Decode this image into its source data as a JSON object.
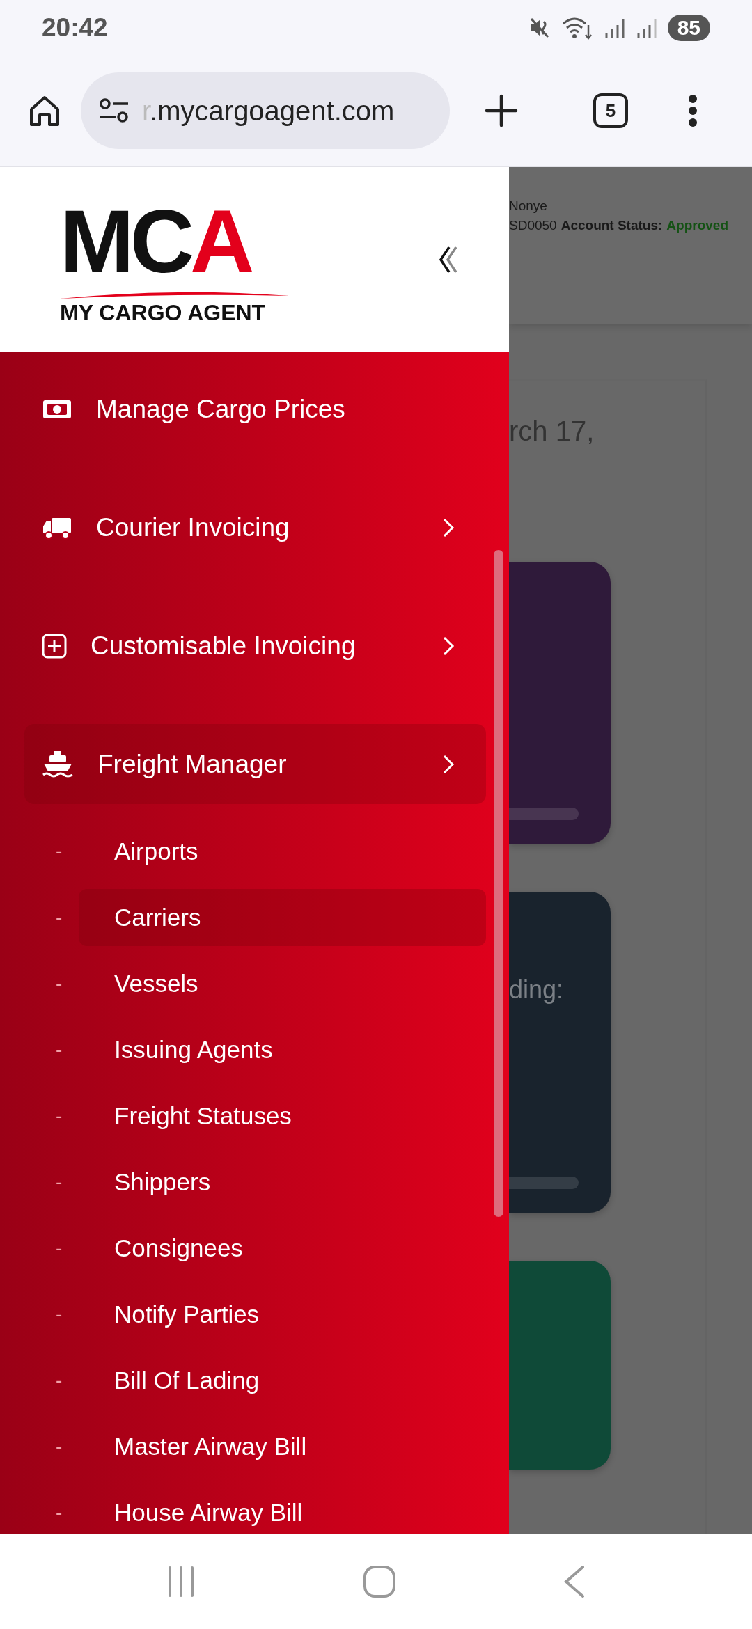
{
  "status_bar": {
    "time": "20:42",
    "battery": "85"
  },
  "browser": {
    "url_hidden": "r",
    "url": ".mycargoagent.com",
    "tab_count": "5"
  },
  "drawer": {
    "logo": {
      "mark": "MCA",
      "tagline": "MY CARGO AGENT"
    },
    "menu": [
      {
        "label": "Manage Cargo Prices",
        "kind": "link",
        "selected": false
      },
      {
        "label": "Courier Invoicing",
        "kind": "group",
        "selected": false
      },
      {
        "label": "Customisable Invoicing",
        "kind": "group",
        "selected": false
      },
      {
        "label": "Freight Manager",
        "kind": "group",
        "selected": true,
        "children": [
          {
            "marker": "-",
            "label": "Airports",
            "selected": false
          },
          {
            "marker": "-",
            "label": "Carriers",
            "selected": true
          },
          {
            "marker": "-",
            "label": "Vessels",
            "selected": false
          },
          {
            "marker": "-",
            "label": "Issuing Agents",
            "selected": false
          },
          {
            "marker": "-",
            "label": "Freight Statuses",
            "selected": false
          },
          {
            "marker": "-",
            "label": "Shippers",
            "selected": false
          },
          {
            "marker": "-",
            "label": "Consignees",
            "selected": false
          },
          {
            "marker": "-",
            "label": "Notify Parties",
            "selected": false
          },
          {
            "marker": "-",
            "label": "Bill Of Lading",
            "selected": false
          },
          {
            "marker": "-",
            "label": "Master Airway Bill",
            "selected": false
          },
          {
            "marker": "-",
            "label": "House Airway Bill",
            "selected": false
          }
        ]
      }
    ]
  },
  "page": {
    "user_name": "Nonye",
    "account_code": "SD0050",
    "account_status_label": "Account Status:",
    "account_status": "Approved",
    "date_text": "rch 17,",
    "cards": [
      {
        "kind": "progress",
        "color": "#2f1a3a"
      },
      {
        "kind": "text",
        "color": "#19232d",
        "text": "ding:"
      },
      {
        "kind": "plain",
        "color": "#0f4a38"
      }
    ]
  }
}
